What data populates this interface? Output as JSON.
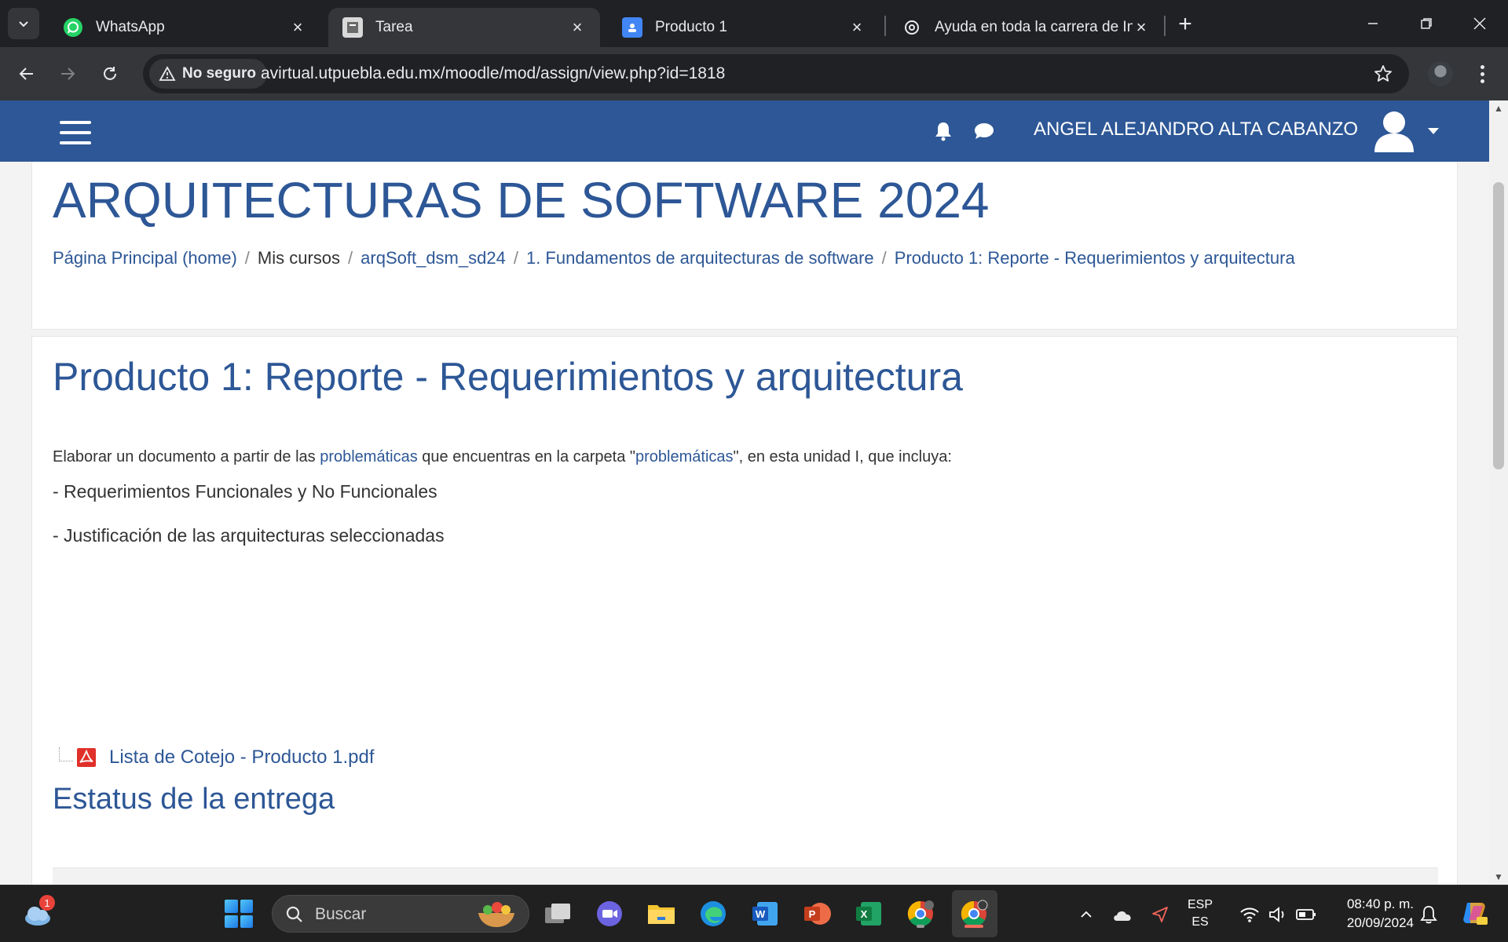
{
  "browser": {
    "tabs": [
      {
        "title": "WhatsApp",
        "active": false
      },
      {
        "title": "Tarea",
        "active": true
      },
      {
        "title": "Producto 1",
        "active": false
      },
      {
        "title": "Ayuda en toda la carrera de Ing",
        "active": false
      }
    ],
    "security_label": "No seguro",
    "url": "avirtual.utpuebla.edu.mx/moodle/mod/assign/view.php?id=1818"
  },
  "moodle": {
    "user_name": "ANGEL ALEJANDRO ALTA CABANZO",
    "course_title": "ARQUITECTURAS DE SOFTWARE 2024",
    "breadcrumb": [
      {
        "label": "Página Principal (home)",
        "link": true
      },
      {
        "label": "Mis cursos",
        "link": false
      },
      {
        "label": "arqSoft_dsm_sd24",
        "link": true
      },
      {
        "label": "1. Fundamentos de arquitecturas de software",
        "link": true
      },
      {
        "label": "Producto 1: Reporte - Requerimientos y arquitectura",
        "link": true
      }
    ],
    "breadcrumb_separator": "/",
    "assignment": {
      "title": "Producto 1: Reporte - Requerimientos y arquitectura",
      "intro": {
        "part1": "Elaborar un documento a partir de las ",
        "link1": "problemáticas",
        "part2": " que encuentras en la carpeta \"",
        "link2": "problemáticas",
        "part3": "\", en esta unidad I,  que incluya:"
      },
      "requirements": [
        "- Requerimientos Funcionales y No Funcionales",
        "- Justificación de las arquitecturas seleccionadas"
      ],
      "attachment": "Lista de Cotejo - Producto 1.pdf",
      "status_heading": "Estatus de la entrega"
    }
  },
  "taskbar": {
    "weather_badge": "1",
    "search_placeholder": "Buscar",
    "lang_top": "ESP",
    "lang_bottom": "ES",
    "time": "08:40 p. m.",
    "date": "20/09/2024"
  },
  "colors": {
    "moodle_brand": "#2d5796",
    "chrome_dark": "#202124",
    "chrome_toolbar": "#35363a",
    "taskbar": "#202020"
  }
}
